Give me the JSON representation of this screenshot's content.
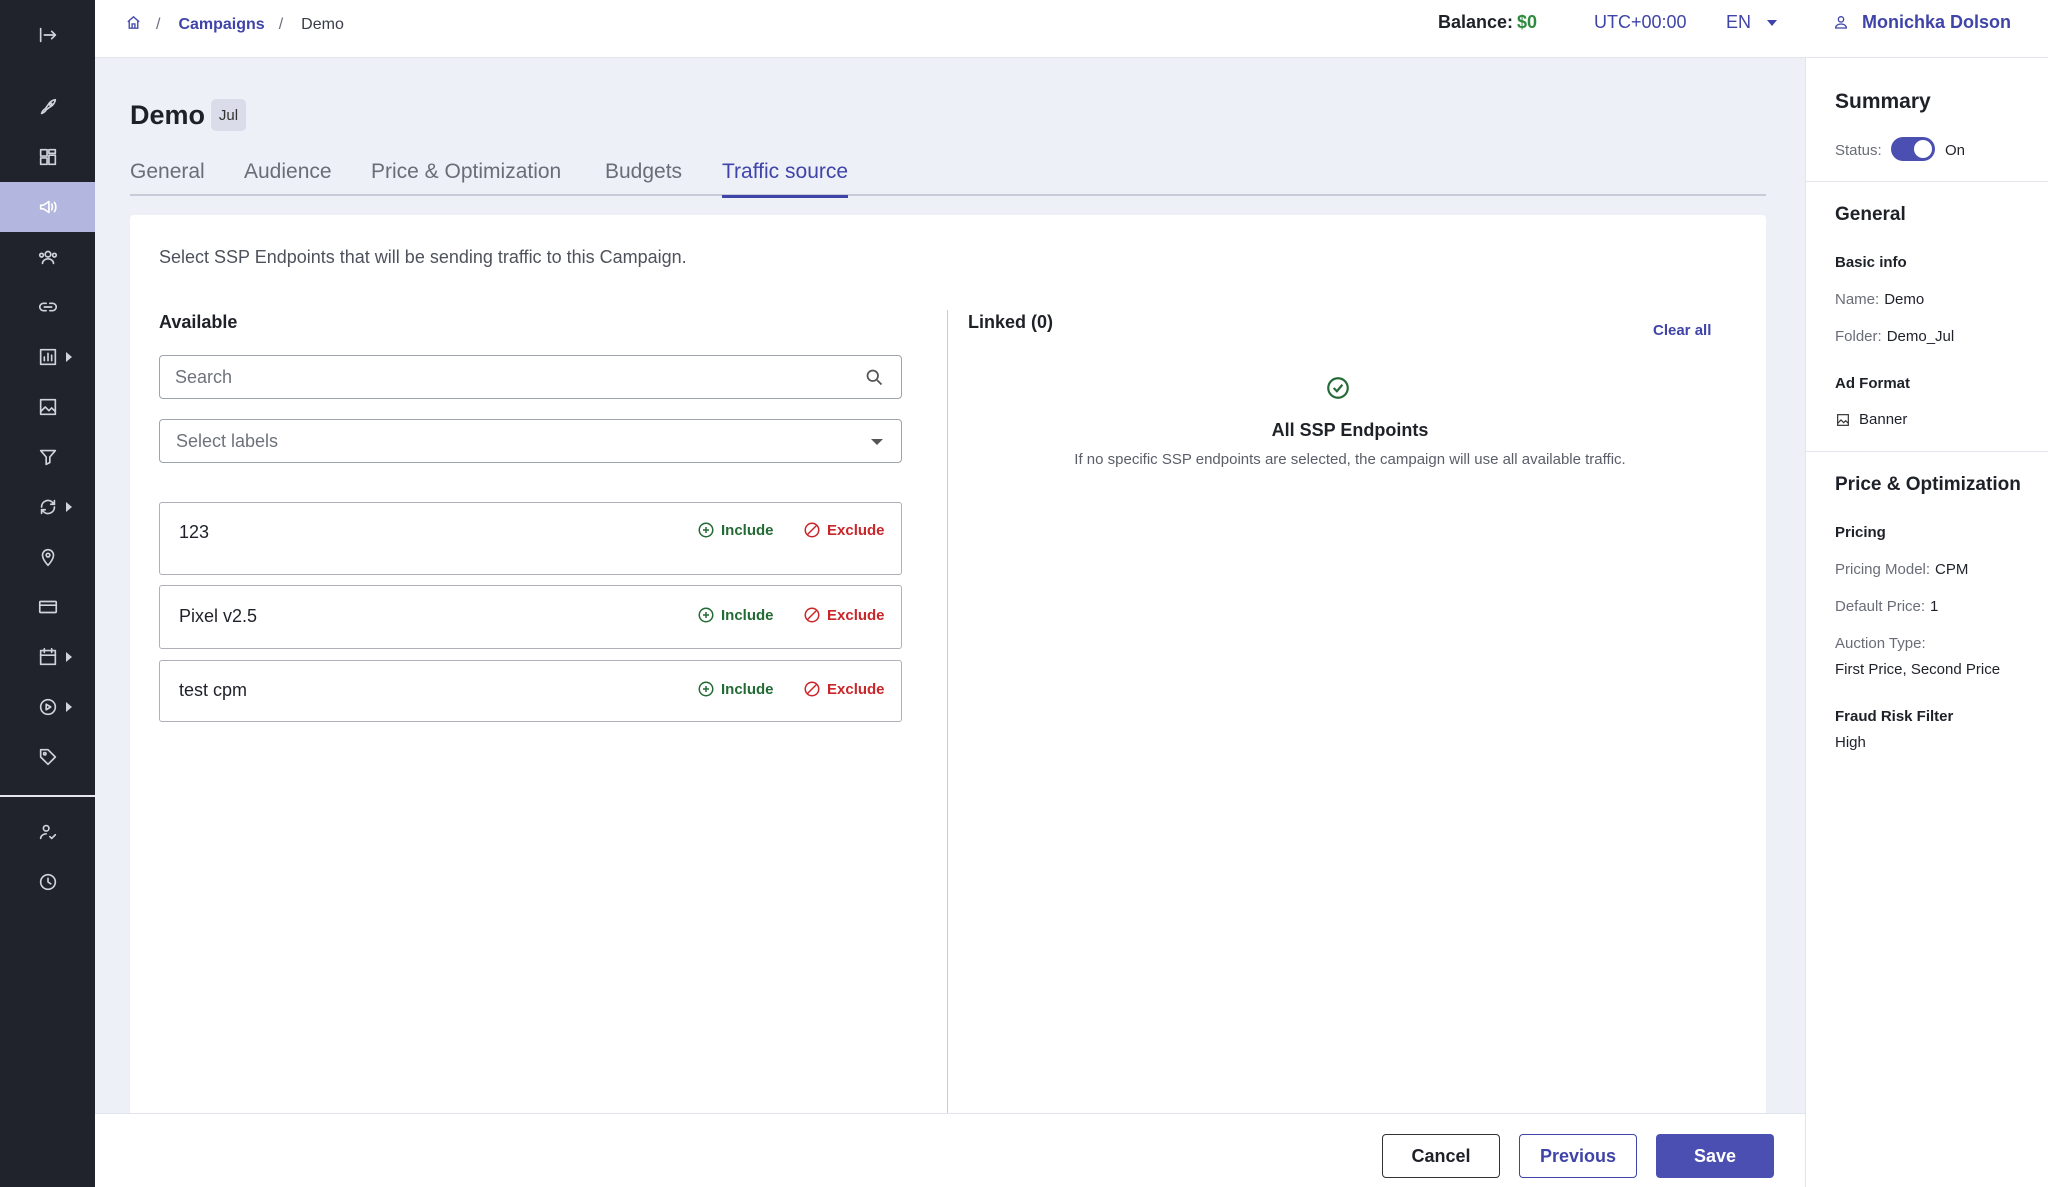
{
  "breadcrumb": {
    "items": [
      "Campaigns",
      "Demo"
    ],
    "separator": "/"
  },
  "header": {
    "balance_label": "Balance:",
    "balance_value": "$0",
    "timezone": "UTC+00:00",
    "language": "EN",
    "user_name": "Monichka Dolson"
  },
  "page": {
    "title": "Demo",
    "badge": "Jul"
  },
  "tabs": [
    {
      "label": "General"
    },
    {
      "label": "Audience"
    },
    {
      "label": "Price & Optimization"
    },
    {
      "label": "Budgets"
    },
    {
      "label": "Traffic source",
      "active": true
    }
  ],
  "traffic": {
    "intro": "Select SSP Endpoints that will be sending traffic to this Campaign.",
    "available_title": "Available",
    "search_placeholder": "Search",
    "labels_placeholder": "Select labels",
    "include_label": "Include",
    "exclude_label": "Exclude",
    "endpoints": [
      {
        "name": "123"
      },
      {
        "name": "Pixel v2.5"
      },
      {
        "name": "test cpm"
      }
    ],
    "linked_title": "Linked (0)",
    "clear_all": "Clear all",
    "empty_title": "All SSP Endpoints",
    "empty_desc": "If no specific SSP endpoints are selected, the campaign will use all available traffic."
  },
  "footer": {
    "cancel": "Cancel",
    "previous": "Previous",
    "save": "Save"
  },
  "summary": {
    "title": "Summary",
    "status_label": "Status:",
    "status_value": "On",
    "status_on": true,
    "general_title": "General",
    "basic_info": "Basic info",
    "name_label": "Name:",
    "name_value": "Demo",
    "folder_label": "Folder:",
    "folder_value": "Demo_Jul",
    "ad_format_title": "Ad Format",
    "ad_format_value": "Banner",
    "price_title": "Price & Optimization",
    "pricing_title": "Pricing",
    "pricing_model_label": "Pricing Model:",
    "pricing_model_value": "CPM",
    "default_price_label": "Default Price:",
    "default_price_value": "1",
    "auction_type_label": "Auction Type:",
    "auction_type_value": "First Price, Second Price",
    "fraud_title": "Fraud Risk Filter",
    "fraud_value": "High"
  },
  "colors": {
    "accent": "#3f44a8",
    "include": "#236b34",
    "exclude": "#c9262a",
    "sidebar": "#20232b",
    "balance": "#2e8b3e"
  },
  "icons": {
    "sidebar": [
      "collapse-icon",
      "rocket-icon",
      "dashboard-icon",
      "megaphone-icon",
      "users-icon",
      "link-icon",
      "chart-icon",
      "image-icon",
      "filter-icon",
      "sync-icon",
      "location-icon",
      "card-icon",
      "calendar-icon",
      "play-icon",
      "tag-icon",
      "user-check-icon",
      "clock-icon"
    ]
  }
}
